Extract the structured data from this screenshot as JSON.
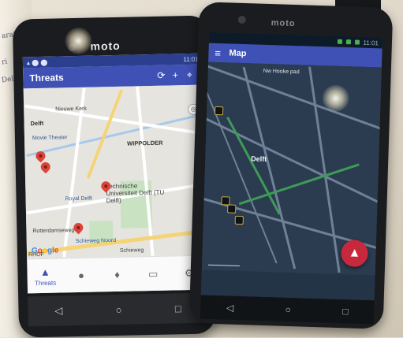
{
  "left_phone": {
    "brand": "moto",
    "status_time": "11:01",
    "app_title": "Threats",
    "actions": {
      "refresh": "⟳",
      "add": "+",
      "location": "⬤"
    },
    "map_labels": {
      "delft_top": "Delft",
      "nieuwe_kerk": "Nieuwe Kerk",
      "movie_theater": "Movie Theater",
      "wippolder": "WIPPOLDER",
      "tu_delft": "Technische Universiteit Delft (TU Delft)",
      "royal_delft": "Royal Delft",
      "rotterdamseweg": "Rotterdamseweg",
      "schieweg_noord": "Schieweg Noord",
      "rhof": "RHOF",
      "schieweg": "Schieweg"
    },
    "google": {
      "g": "G",
      "o1": "o",
      "o2": "o",
      "g2": "g",
      "l": "l",
      "e": "e"
    },
    "bottom_nav": [
      {
        "label": "Threats",
        "icon": "▲"
      },
      {
        "label": "",
        "icon": "❗"
      },
      {
        "label": "",
        "icon": "🔔"
      },
      {
        "label": "",
        "icon": "✉"
      },
      {
        "label": "",
        "icon": "⚙"
      }
    ],
    "system_nav": {
      "back": "◁",
      "home": "○",
      "recents": "□"
    }
  },
  "right_phone": {
    "brand": "moto",
    "status_time": "11:01",
    "app_title": "Map",
    "map_labels": {
      "top_label": "Nw Hooke pad",
      "delft": "Delft"
    },
    "system_nav": {
      "back": "◁",
      "home": "○",
      "recents": "□"
    },
    "fab_icon": "▲"
  },
  "colors": {
    "app_bar": "#3f51b5",
    "threat_pin": "#db4437",
    "fab": "#c8283c"
  }
}
